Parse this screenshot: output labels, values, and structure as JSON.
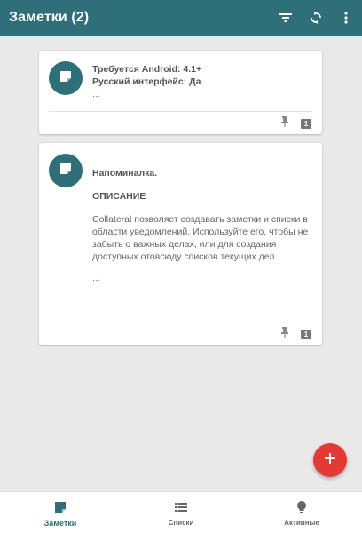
{
  "appbar": {
    "title": "Заметки (2)",
    "actions": [
      "filter-icon",
      "sync-icon",
      "more-vert-icon"
    ],
    "color": "#2e6f7a"
  },
  "notes": [
    {
      "icon": "note-icon",
      "lines": [
        "Требуется Android: 4.1+",
        "Русский интерфейс: Да"
      ],
      "ellipsis": "...",
      "count": "1"
    },
    {
      "icon": "note-icon",
      "title": "Напоминалка.",
      "heading": "ОПИСАНИЕ",
      "body": "Collateral позволяет создавать заметки и списки в области уведомлений. Используйте его, чтобы не забыть о важных делах, или для создания доступных отовсюду списков текущих дел.",
      "ellipsis": "...",
      "count": "1"
    }
  ],
  "fab": {
    "icon": "plus-icon",
    "color": "#e53935"
  },
  "bottom_nav": {
    "items": [
      {
        "label": "Заметки",
        "icon": "note-icon",
        "active": true
      },
      {
        "label": "Списки",
        "icon": "list-icon",
        "active": false
      },
      {
        "label": "Активные",
        "icon": "bulb-icon",
        "active": false
      }
    ]
  }
}
